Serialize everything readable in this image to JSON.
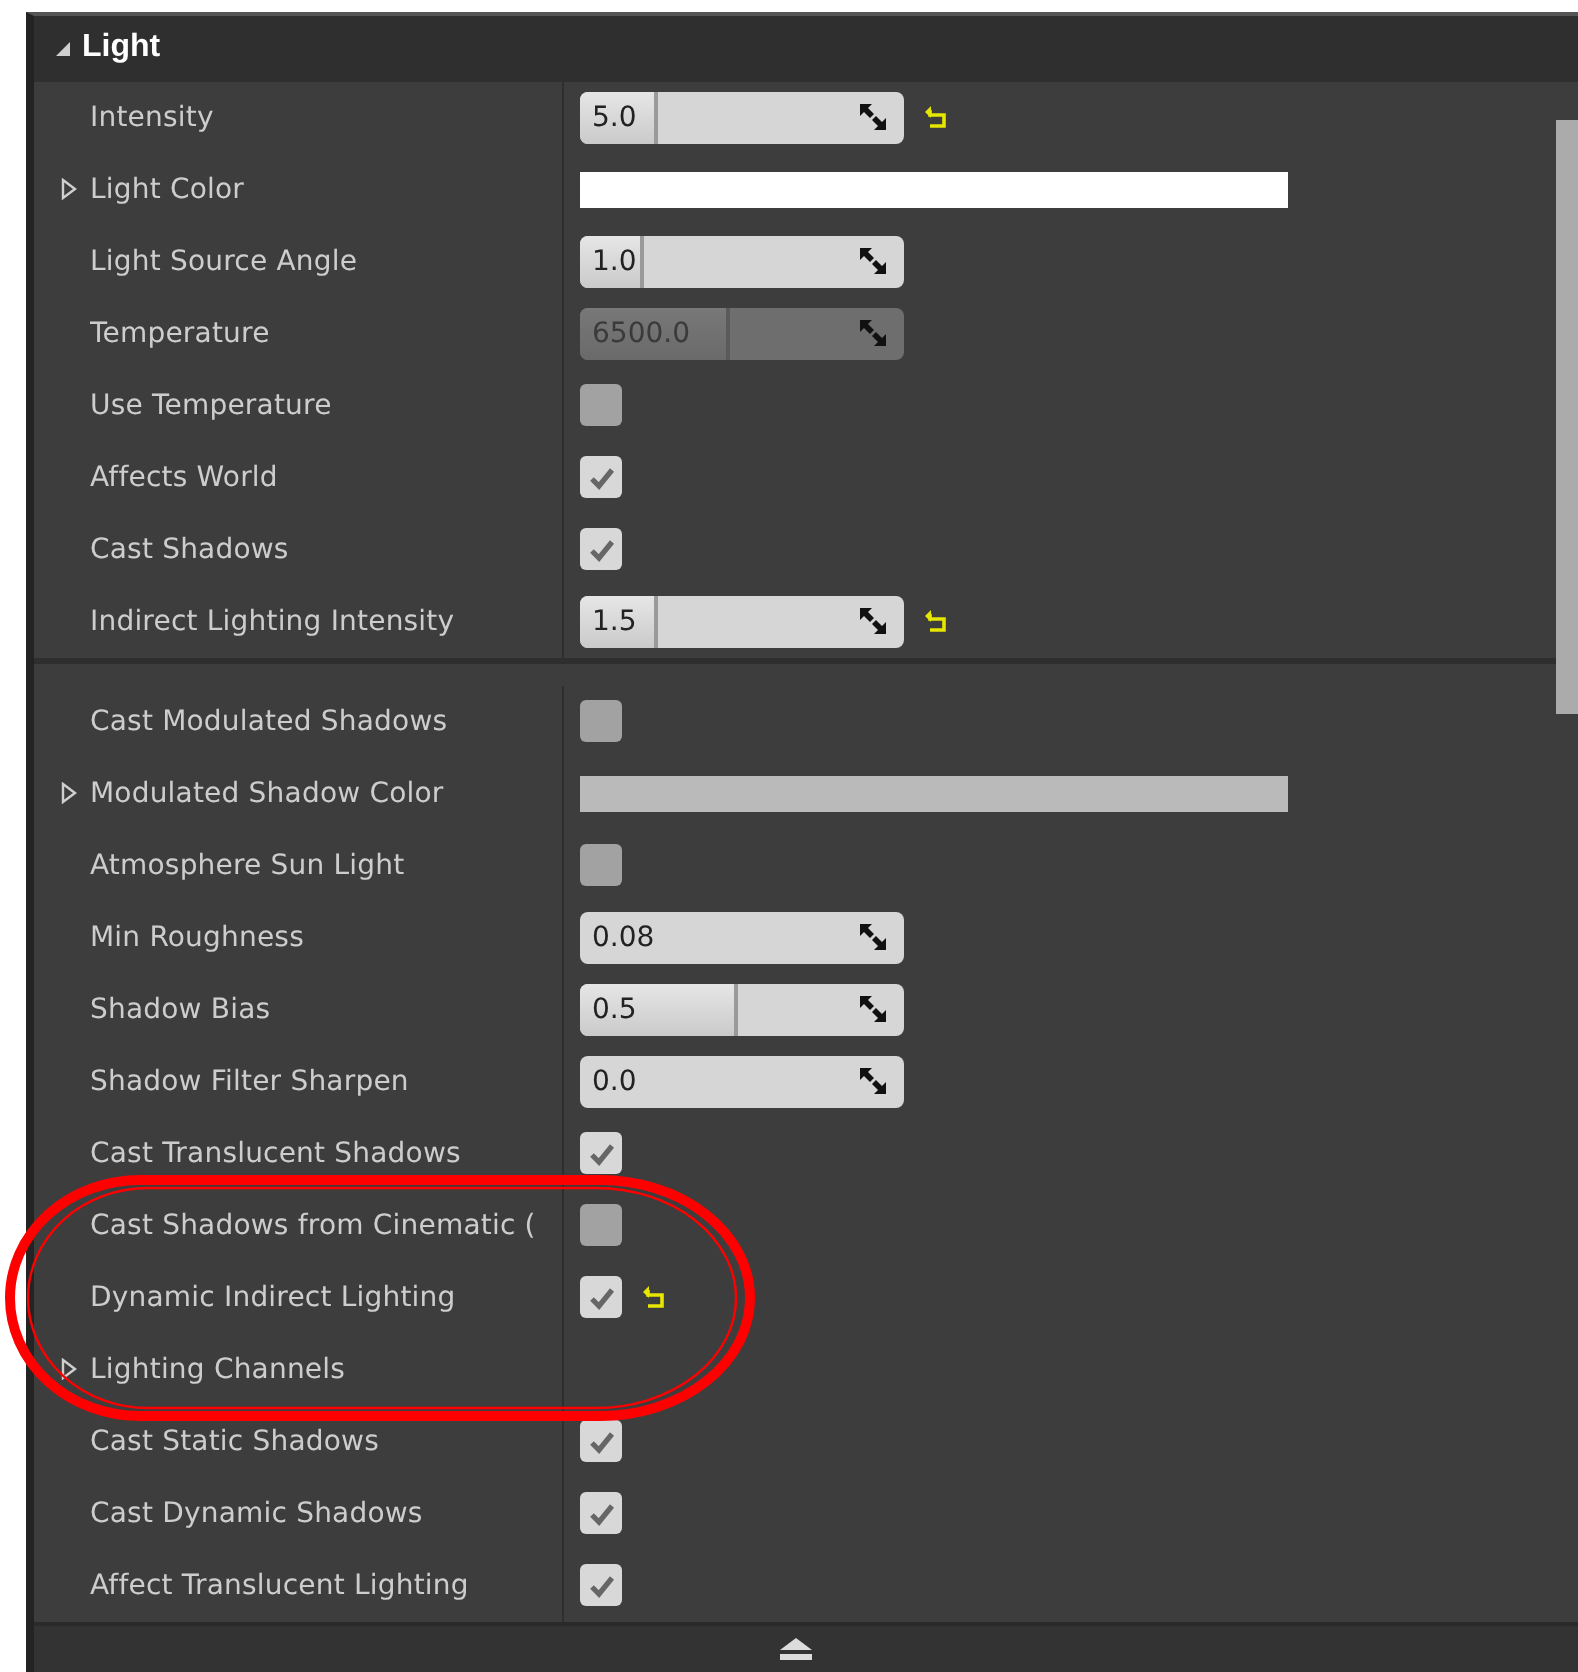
{
  "section": {
    "title": "Light",
    "expanded": true
  },
  "groups": [
    {
      "rows": [
        {
          "label": "Intensity",
          "kind": "number",
          "value": "5.0",
          "level": 0.24,
          "disabled": false,
          "reset": true
        },
        {
          "label": "Light Color",
          "kind": "color",
          "color": "#ffffff",
          "expanded": false
        },
        {
          "label": "Light Source Angle",
          "kind": "number",
          "value": "1.0",
          "level": 0.2,
          "disabled": false
        },
        {
          "label": "Temperature",
          "kind": "number",
          "value": "6500.0",
          "level": 0.46,
          "disabled": true
        },
        {
          "label": "Use Temperature",
          "kind": "checkbox",
          "checked": false
        },
        {
          "label": "Affects World",
          "kind": "checkbox",
          "checked": true
        },
        {
          "label": "Cast Shadows",
          "kind": "checkbox",
          "checked": true
        },
        {
          "label": "Indirect Lighting Intensity",
          "kind": "number",
          "value": "1.5",
          "level": 0.24,
          "disabled": false,
          "reset": true
        }
      ]
    },
    {
      "rows": [
        {
          "label": "Cast Modulated Shadows",
          "kind": "checkbox",
          "checked": false
        },
        {
          "label": "Modulated Shadow Color",
          "kind": "color",
          "color": "#bababa",
          "expanded": false
        },
        {
          "label": "Atmosphere Sun Light",
          "kind": "checkbox",
          "checked": false
        },
        {
          "label": "Min Roughness",
          "kind": "number",
          "value": "0.08",
          "level": 0,
          "disabled": false
        },
        {
          "label": "Shadow Bias",
          "kind": "number",
          "value": "0.5",
          "level": 0.49,
          "disabled": false
        },
        {
          "label": "Shadow Filter Sharpen",
          "kind": "number",
          "value": "0.0",
          "level": 0,
          "disabled": false
        },
        {
          "label": "Cast Translucent Shadows",
          "kind": "checkbox",
          "checked": true
        },
        {
          "label": "Cast Shadows from Cinematic (",
          "kind": "checkbox",
          "checked": false
        },
        {
          "label": "Dynamic Indirect Lighting",
          "kind": "checkbox",
          "checked": true,
          "reset": true
        },
        {
          "label": "Lighting Channels",
          "kind": "group",
          "expanded": false
        },
        {
          "label": "Cast Static Shadows",
          "kind": "checkbox",
          "checked": true
        },
        {
          "label": "Cast Dynamic Shadows",
          "kind": "checkbox",
          "checked": true
        },
        {
          "label": "Affect Translucent Lighting",
          "kind": "checkbox",
          "checked": true
        }
      ]
    }
  ]
}
